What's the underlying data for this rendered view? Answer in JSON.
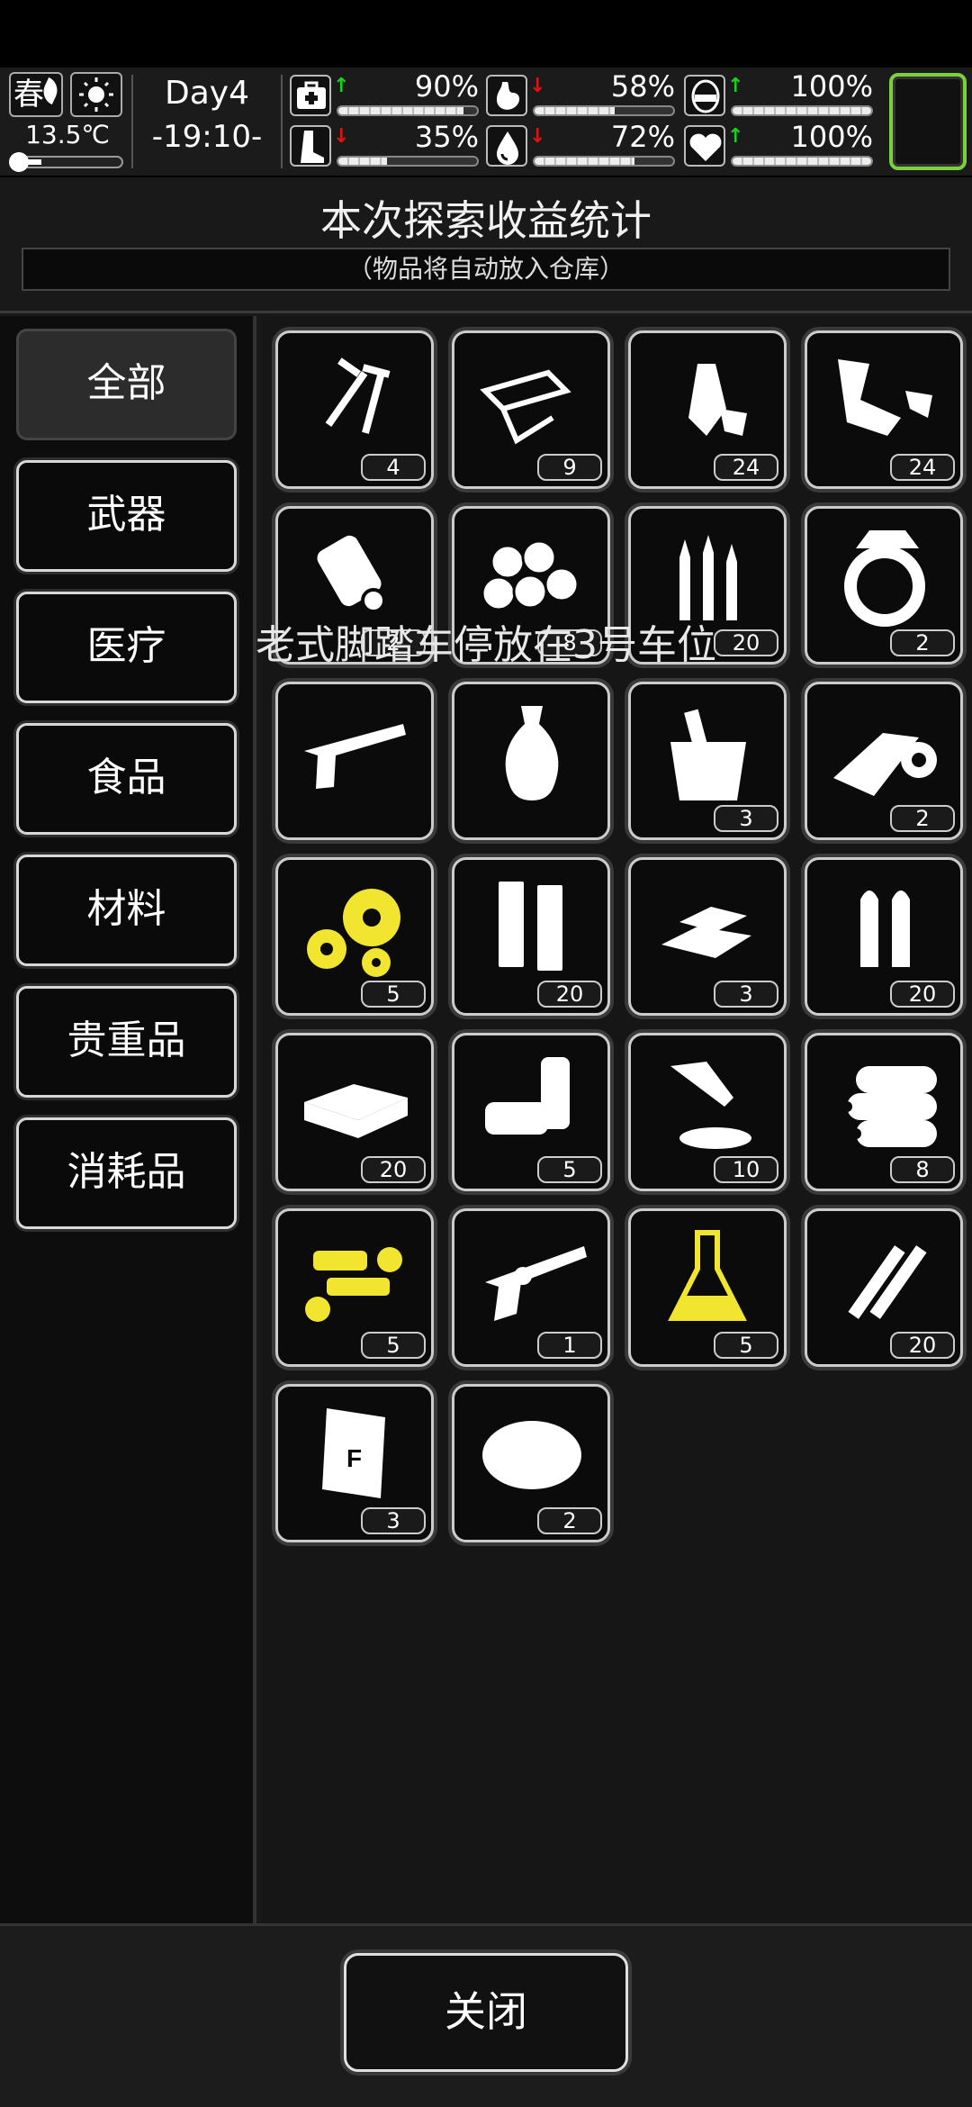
{
  "hud": {
    "season": "春",
    "temperature": "13.5℃",
    "day": "Day4",
    "time": "-19:10-",
    "stats": [
      {
        "name": "health",
        "icon": "medkit-icon",
        "trend": "up",
        "value": "90%",
        "level": 0.9
      },
      {
        "name": "hunger",
        "icon": "stomach-icon",
        "trend": "down",
        "value": "58%",
        "level": 0.58
      },
      {
        "name": "mood",
        "icon": "face-icon",
        "trend": "up",
        "value": "100%",
        "level": 1.0
      },
      {
        "name": "stamina",
        "icon": "boot-icon",
        "trend": "down",
        "value": "35%",
        "level": 0.35
      },
      {
        "name": "thirst",
        "icon": "water-drop-icon",
        "trend": "down",
        "value": "72%",
        "level": 0.72
      },
      {
        "name": "heart",
        "icon": "heart-icon",
        "trend": "up",
        "value": "100%",
        "level": 1.0
      }
    ],
    "thermometer_level": 0.2
  },
  "panel": {
    "title": "本次探索收益统计",
    "subtitle": "（物品将自动放入仓库）"
  },
  "categories": [
    "全部",
    "武器",
    "医疗",
    "食品",
    "材料",
    "贵重品",
    "消耗品"
  ],
  "active_category": "全部",
  "items": [
    {
      "icon": "screws-icon",
      "count": "4",
      "color": "#ffffff"
    },
    {
      "icon": "paper-scrap-icon",
      "count": "9",
      "color": "#ffffff"
    },
    {
      "icon": "plastic-bottle-icon",
      "count": "24",
      "color": "#ffffff"
    },
    {
      "icon": "cloth-scraps-icon",
      "count": "24",
      "color": "#ffffff"
    },
    {
      "icon": "bandage-roll-icon",
      "count": "2",
      "color": "#ffffff"
    },
    {
      "icon": "cotton-balls-icon",
      "count": "8",
      "color": "#ffffff"
    },
    {
      "icon": "rifle-bullets-icon",
      "count": "20",
      "color": "#ffffff"
    },
    {
      "icon": "diamond-ring-icon",
      "count": "2",
      "color": "#ffffff"
    },
    {
      "icon": "pistol-icon",
      "count": "",
      "color": "#ffffff"
    },
    {
      "icon": "vase-icon",
      "count": "",
      "color": "#ffffff"
    },
    {
      "icon": "bucket-icon",
      "count": "3",
      "color": "#ffffff"
    },
    {
      "icon": "tape-roll-icon",
      "count": "2",
      "color": "#ffffff"
    },
    {
      "icon": "gears-icon",
      "count": "5",
      "color": "#f1e530"
    },
    {
      "icon": "magazines-icon",
      "count": "20",
      "color": "#ffffff"
    },
    {
      "icon": "gold-bars-icon",
      "count": "3",
      "color": "#ffffff"
    },
    {
      "icon": "pistol-bullets-icon",
      "count": "20",
      "color": "#ffffff"
    },
    {
      "icon": "cash-stack-icon",
      "count": "20",
      "color": "#ffffff"
    },
    {
      "icon": "cans-icon",
      "count": "5",
      "color": "#ffffff"
    },
    {
      "icon": "glue-tube-icon",
      "count": "10",
      "color": "#ffffff"
    },
    {
      "icon": "logs-icon",
      "count": "8",
      "color": "#ffffff"
    },
    {
      "icon": "machine-parts-icon",
      "count": "5",
      "color": "#f1e530"
    },
    {
      "icon": "revolver-icon",
      "count": "1",
      "color": "#ffffff"
    },
    {
      "icon": "chemical-flask-icon",
      "count": "5",
      "color": "#f1e530"
    },
    {
      "icon": "shotgun-shells-icon",
      "count": "20",
      "color": "#ffffff"
    },
    {
      "icon": "fertilizer-bag-icon",
      "count": "3",
      "color": "#ffffff"
    },
    {
      "icon": "fiber-bundle-icon",
      "count": "2",
      "color": "#ffffff"
    }
  ],
  "toast": "老式脚踏车停放在3号车位",
  "close_label": "关闭"
}
